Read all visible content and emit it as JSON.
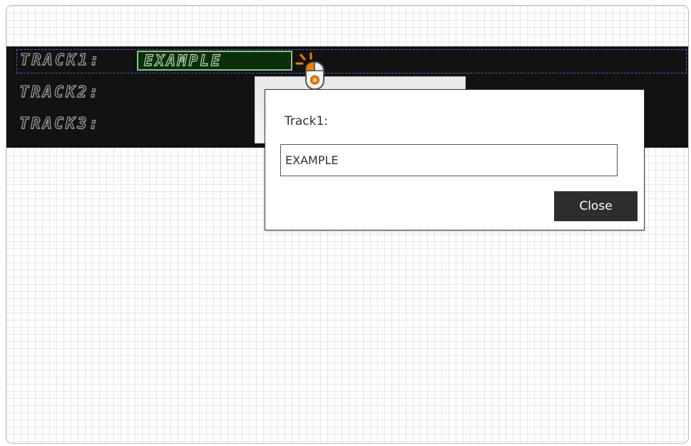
{
  "display": {
    "tracks": [
      {
        "label": "TRACK1:",
        "value": "EXAMPLE"
      },
      {
        "label": "TRACK2:"
      },
      {
        "label": "TRACK3:"
      }
    ]
  },
  "dialog": {
    "title": "Track1:",
    "input_value": "EXAMPLE",
    "close_label": "Close"
  },
  "colors": {
    "display_bg": "#121212",
    "value_box_bg": "#0b2e0b",
    "value_box_border": "#7fc97f",
    "selection_border": "#5a5ad6",
    "close_button_bg": "#2e2e2e",
    "cursor_accent": "#f07d00"
  },
  "icons": {
    "cursor": "mouse-left-click-icon"
  }
}
